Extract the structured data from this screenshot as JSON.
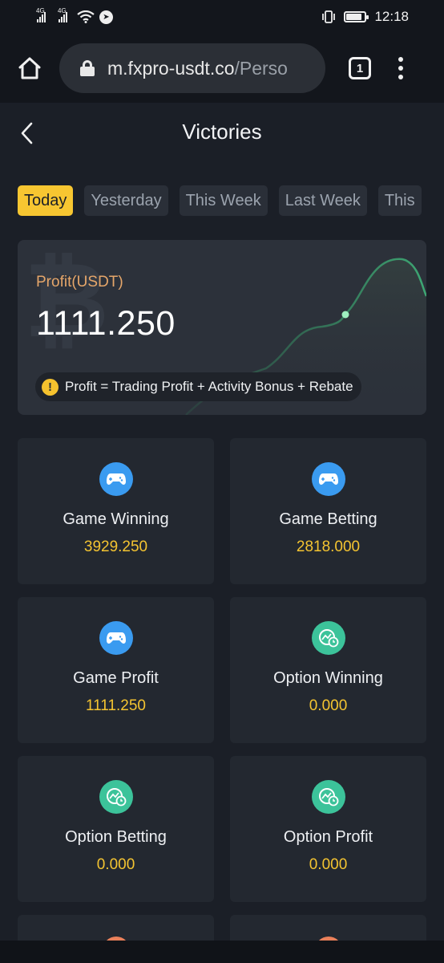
{
  "status": {
    "sim1": "4G",
    "sim2": "4G",
    "time": "12:18"
  },
  "browser": {
    "url_main": "m.fxpro-usdt.co",
    "url_rest": "/Perso",
    "tab_count": "1"
  },
  "header": {
    "title": "Victories"
  },
  "filters": [
    {
      "label": "Today",
      "active": true
    },
    {
      "label": "Yesterday",
      "active": false
    },
    {
      "label": "This Week",
      "active": false
    },
    {
      "label": "Last Week",
      "active": false
    },
    {
      "label": "This",
      "active": false
    }
  ],
  "profit": {
    "label": "Profit(USDT)",
    "value": "1111.250",
    "note": "Profit = Trading Profit + Activity Bonus + Rebate"
  },
  "stats": [
    {
      "label": "Game Winning",
      "value": "3929.250",
      "icon": "gamepad-icon",
      "color": "#3a9bf0"
    },
    {
      "label": "Game Betting",
      "value": "2818.000",
      "icon": "gamepad-icon",
      "color": "#3a9bf0"
    },
    {
      "label": "Game Profit",
      "value": "1111.250",
      "icon": "gamepad-icon",
      "color": "#3a9bf0"
    },
    {
      "label": "Option Winning",
      "value": "0.000",
      "icon": "chart-clock-icon",
      "color": "#3cc39a"
    },
    {
      "label": "Option Betting",
      "value": "0.000",
      "icon": "chart-clock-icon",
      "color": "#3cc39a"
    },
    {
      "label": "Option Profit",
      "value": "0.000",
      "icon": "chart-clock-icon",
      "color": "#3cc39a"
    }
  ],
  "colors": {
    "accent": "#f7c631",
    "profit_label": "#e5a66a",
    "background": "#1b1f27"
  }
}
